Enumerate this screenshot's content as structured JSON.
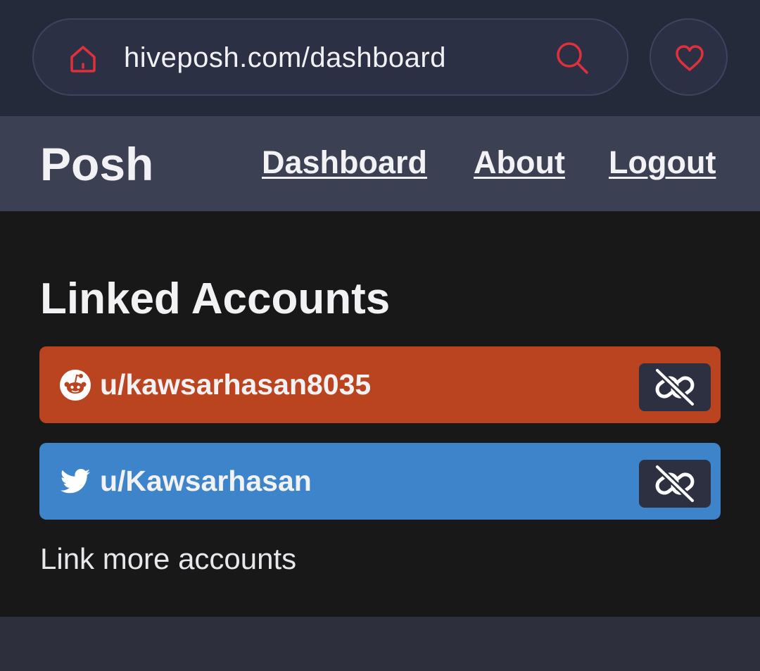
{
  "browser": {
    "url": "hiveposh.com/dashboard",
    "icons": {
      "home": "home-icon",
      "search": "search-icon",
      "favorite": "heart-icon"
    },
    "icon_color": "#e0303c"
  },
  "header": {
    "brand": "Posh",
    "nav": [
      {
        "label": "Dashboard"
      },
      {
        "label": "About"
      },
      {
        "label": "Logout"
      }
    ]
  },
  "main": {
    "title": "Linked Accounts",
    "accounts": [
      {
        "platform_icon": "reddit-icon",
        "handle": "u/kawsarhasan8035",
        "color": "#bb4420",
        "action_icon": "unlink-icon"
      },
      {
        "platform_icon": "twitter-icon",
        "handle": "u/Kawsarhasan",
        "color": "#3d84cb",
        "action_icon": "unlink-icon"
      }
    ],
    "link_more": "Link more accounts"
  }
}
